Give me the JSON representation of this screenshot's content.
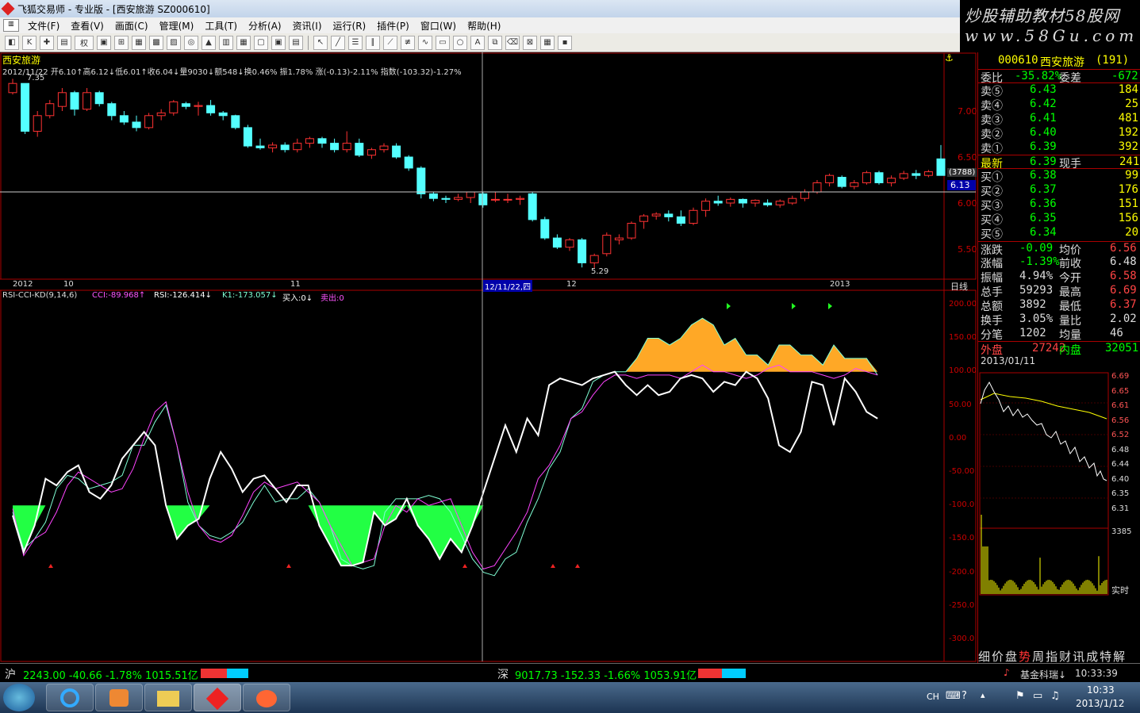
{
  "window": {
    "title": "飞狐交易师 - 专业版 - [西安旅游 SZ000610]"
  },
  "menu": [
    "文件(F)",
    "查看(V)",
    "画面(C)",
    "管理(M)",
    "工具(T)",
    "分析(A)",
    "资讯(I)",
    "运行(R)",
    "插件(P)",
    "窗口(W)",
    "帮助(H)"
  ],
  "toolbar_quan": "权",
  "brand": {
    "line1": "炒股辅助教材58股网",
    "line2": "www.58Gu.com"
  },
  "chart_header": {
    "name": "西安旅游",
    "info": "2012/11/22  开6.10↑高6.12↓低6.01↑收6.04↓量9030↓额548↓换0.46% 振1.78% 涨(-0.13)-2.11% 指数(-103.32)-1.27%"
  },
  "price_axis": {
    "labels": [
      "7.00",
      "6.50",
      "6.00",
      "5.50"
    ],
    "max_label": "7.35",
    "min_label": "5.29",
    "cursor_box": [
      "(3788)",
      "6.13"
    ],
    "period": "日线"
  },
  "date_axis": [
    "2012",
    "10",
    "11",
    "12/11/22,四",
    "12",
    "2013"
  ],
  "indicator": {
    "name": "RSI-CCI-KD(9,14,6)",
    "cci": "CCI:-89.968↑",
    "rsi": "RSI:-126.414↓",
    "k1": "K1:-173.057↓",
    "buy": "买入:0↓",
    "sell": "卖出:0",
    "axis": [
      "200.00",
      "150.00",
      "100.00",
      "50.00",
      "0.00",
      "-50.00",
      "-100.0",
      "-150.0",
      "-200.0",
      "-250.0",
      "-300.0"
    ]
  },
  "quote": {
    "code": "000610",
    "name": "西安旅游",
    "count": "(191)",
    "weibi": {
      "label": "委比",
      "value": "-35.82%",
      "label2": "委差",
      "value2": "-672"
    },
    "sell": [
      {
        "label": "卖⑤",
        "price": "6.43",
        "vol": "184"
      },
      {
        "label": "卖④",
        "price": "6.42",
        "vol": "25"
      },
      {
        "label": "卖③",
        "price": "6.41",
        "vol": "481"
      },
      {
        "label": "卖②",
        "price": "6.40",
        "vol": "192"
      },
      {
        "label": "卖①",
        "price": "6.39",
        "vol": "392"
      }
    ],
    "latest": {
      "label": "最新",
      "price": "6.39",
      "label2": "现手",
      "vol": "241"
    },
    "buy": [
      {
        "label": "买①",
        "price": "6.38",
        "vol": "99"
      },
      {
        "label": "买②",
        "price": "6.37",
        "vol": "176"
      },
      {
        "label": "买③",
        "price": "6.36",
        "vol": "151"
      },
      {
        "label": "买④",
        "price": "6.35",
        "vol": "156"
      },
      {
        "label": "买⑤",
        "price": "6.34",
        "vol": "20"
      }
    ],
    "stats": [
      {
        "l1": "涨跌",
        "v1": "-0.09",
        "l2": "均价",
        "v2": "6.56"
      },
      {
        "l1": "涨幅",
        "v1": "-1.39%",
        "l2": "前收",
        "v2": "6.48"
      },
      {
        "l1": "振幅",
        "v1": "4.94%",
        "l2": "今开",
        "v2": "6.58"
      },
      {
        "l1": "总手",
        "v1": "59293",
        "l2": "最高",
        "v2": "6.69"
      },
      {
        "l1": "总额",
        "v1": "3892",
        "l2": "最低",
        "v2": "6.37"
      },
      {
        "l1": "换手",
        "v1": "3.05%",
        "l2": "量比",
        "v2": "2.02"
      },
      {
        "l1": "分笔",
        "v1": "1202",
        "l2": "均量",
        "v2": "46"
      }
    ],
    "outer": {
      "label": "外盘",
      "value": "27242",
      "label2": "内盘",
      "value2": "32051"
    }
  },
  "mini": {
    "date": "2013/01/11",
    "ticks": [
      "6.69",
      "6.65",
      "6.61",
      "6.56",
      "6.52",
      "6.48",
      "6.44",
      "6.40",
      "6.35",
      "6.31"
    ],
    "vol_max": "3385",
    "mode": "实时"
  },
  "bottom_tabs": [
    "细",
    "价",
    "盘",
    "势",
    "周",
    "指",
    "财",
    "讯",
    "成",
    "特",
    "解"
  ],
  "status": {
    "sh_label": "沪",
    "sh": "2243.00 -40.66 -1.78% 1015.51亿",
    "sz_label": "深",
    "sz": "9017.73 -152.33 -1.66% 1053.91亿",
    "fund": "基金科瑞↓",
    "time": "10:33:39"
  },
  "taskbar": {
    "time": "10:33",
    "date": "2013/1/12",
    "lang": "CH"
  },
  "chart_data": {
    "type": "candlestick",
    "ohlc": [
      [
        7.2,
        7.35,
        7.18,
        7.3
      ],
      [
        7.3,
        7.3,
        6.75,
        6.78
      ],
      [
        6.78,
        7.0,
        6.72,
        6.95
      ],
      [
        6.95,
        7.12,
        6.92,
        7.08
      ],
      [
        7.05,
        7.25,
        7.0,
        7.2
      ],
      [
        7.2,
        7.22,
        6.95,
        7.02
      ],
      [
        7.02,
        7.25,
        7.0,
        7.2
      ],
      [
        7.2,
        7.22,
        7.05,
        7.08
      ],
      [
        7.08,
        7.1,
        6.9,
        6.95
      ],
      [
        6.95,
        7.0,
        6.85,
        6.88
      ],
      [
        6.88,
        6.95,
        6.78,
        6.82
      ],
      [
        6.82,
        6.98,
        6.8,
        6.95
      ],
      [
        6.95,
        7.02,
        6.9,
        6.98
      ],
      [
        6.98,
        7.12,
        6.95,
        7.1
      ],
      [
        7.08,
        7.1,
        7.02,
        7.05
      ],
      [
        7.05,
        7.1,
        6.95,
        7.06
      ],
      [
        7.06,
        7.12,
        6.95,
        6.98
      ],
      [
        6.98,
        7.0,
        6.9,
        6.95
      ],
      [
        6.95,
        6.96,
        6.8,
        6.82
      ],
      [
        6.82,
        6.85,
        6.6,
        6.62
      ],
      [
        6.62,
        6.7,
        6.58,
        6.6
      ],
      [
        6.6,
        6.66,
        6.55,
        6.63
      ],
      [
        6.63,
        6.66,
        6.55,
        6.58
      ],
      [
        6.58,
        6.7,
        6.55,
        6.65
      ],
      [
        6.65,
        6.72,
        6.6,
        6.7
      ],
      [
        6.7,
        6.72,
        6.6,
        6.65
      ],
      [
        6.65,
        6.7,
        6.55,
        6.58
      ],
      [
        6.58,
        6.78,
        6.55,
        6.65
      ],
      [
        6.65,
        6.7,
        6.5,
        6.52
      ],
      [
        6.52,
        6.6,
        6.48,
        6.58
      ],
      [
        6.58,
        6.65,
        6.55,
        6.62
      ],
      [
        6.62,
        6.65,
        6.48,
        6.5
      ],
      [
        6.5,
        6.52,
        6.35,
        6.38
      ],
      [
        6.38,
        6.4,
        6.05,
        6.1
      ],
      [
        6.1,
        6.12,
        6.02,
        6.05
      ],
      [
        6.05,
        6.08,
        6.0,
        6.04
      ],
      [
        6.04,
        6.1,
        6.02,
        6.06
      ],
      [
        6.06,
        6.12,
        6.0,
        6.12
      ],
      [
        6.1,
        6.12,
        5.95,
        5.98
      ],
      [
        6.04,
        6.12,
        6.01,
        6.04
      ],
      [
        6.04,
        6.1,
        6.0,
        6.04
      ],
      [
        6.04,
        6.08,
        5.98,
        6.05
      ],
      [
        6.1,
        6.12,
        5.8,
        5.82
      ],
      [
        5.82,
        5.85,
        5.6,
        5.62
      ],
      [
        5.62,
        5.66,
        5.5,
        5.52
      ],
      [
        5.52,
        5.62,
        5.48,
        5.6
      ],
      [
        5.6,
        5.62,
        5.3,
        5.35
      ],
      [
        5.35,
        5.45,
        5.29,
        5.43
      ],
      [
        5.45,
        5.68,
        5.42,
        5.65
      ],
      [
        5.6,
        5.66,
        5.55,
        5.62
      ],
      [
        5.62,
        5.8,
        5.6,
        5.78
      ],
      [
        5.8,
        5.88,
        5.72,
        5.86
      ],
      [
        5.86,
        5.9,
        5.82,
        5.88
      ],
      [
        5.88,
        5.92,
        5.8,
        5.85
      ],
      [
        5.85,
        5.92,
        5.75,
        5.78
      ],
      [
        5.78,
        5.95,
        5.76,
        5.92
      ],
      [
        5.92,
        6.05,
        5.85,
        6.02
      ],
      [
        6.02,
        6.08,
        5.97,
        6.0
      ],
      [
        6.0,
        6.06,
        5.96,
        6.04
      ],
      [
        6.04,
        6.05,
        5.95,
        6.0
      ],
      [
        6.0,
        6.04,
        5.96,
        6.03
      ],
      [
        6.0,
        6.04,
        5.96,
        5.98
      ],
      [
        5.98,
        6.04,
        5.95,
        6.02
      ],
      [
        6.0,
        6.08,
        5.98,
        6.05
      ],
      [
        6.05,
        6.15,
        6.02,
        6.12
      ],
      [
        6.12,
        6.25,
        6.1,
        6.22
      ],
      [
        6.22,
        6.32,
        6.18,
        6.3
      ],
      [
        6.28,
        6.3,
        6.16,
        6.18
      ],
      [
        6.18,
        6.25,
        6.15,
        6.22
      ],
      [
        6.22,
        6.35,
        6.2,
        6.33
      ],
      [
        6.33,
        6.35,
        6.2,
        6.22
      ],
      [
        6.22,
        6.3,
        6.18,
        6.27
      ],
      [
        6.27,
        6.35,
        6.25,
        6.32
      ],
      [
        6.32,
        6.36,
        6.26,
        6.3
      ],
      [
        6.3,
        6.36,
        6.28,
        6.34
      ],
      [
        6.48,
        6.63,
        6.3,
        6.3
      ]
    ],
    "indicator": {
      "k1": [
        -110,
        -165,
        -150,
        -125,
        -75,
        -55,
        -60,
        -75,
        -70,
        -65,
        -55,
        -10,
        -10,
        25,
        50,
        -10,
        -95,
        -130,
        -145,
        -150,
        -140,
        -125,
        -95,
        -70,
        -95,
        -90,
        -90,
        -75,
        -95,
        -130,
        -180,
        -190,
        -195,
        -190,
        -110,
        -90,
        -90,
        -90,
        -85,
        -90,
        -110,
        -145,
        -180,
        -200,
        -205,
        -180,
        -170,
        -125,
        -90,
        -45,
        -20,
        30,
        45,
        85,
        95,
        100,
        100,
        120,
        150,
        150,
        140,
        150,
        170,
        180,
        170,
        140,
        150,
        125,
        125,
        110,
        140,
        140,
        125,
        125,
        110,
        140,
        120,
        120,
        120,
        95
      ],
      "cci": [
        -105,
        -175,
        -150,
        -140,
        -110,
        -70,
        -50,
        -60,
        -70,
        -80,
        -75,
        -45,
        0,
        40,
        55,
        -10,
        -80,
        -130,
        -150,
        -155,
        -145,
        -115,
        -80,
        -65,
        -75,
        -70,
        -65,
        -80,
        -95,
        -130,
        -160,
        -190,
        -185,
        -180,
        -130,
        -100,
        -110,
        -90,
        -100,
        -95,
        -90,
        -130,
        -170,
        -195,
        -190,
        -165,
        -140,
        -110,
        -60,
        -40,
        -10,
        30,
        40,
        65,
        85,
        95,
        95,
        90,
        95,
        95,
        95,
        90,
        100,
        110,
        100,
        100,
        95,
        90,
        95,
        105,
        110,
        100,
        100,
        100,
        95,
        90,
        95,
        105,
        100,
        95
      ],
      "rsi": [
        -115,
        -170,
        -130,
        -60,
        -70,
        -50,
        -40,
        -80,
        -90,
        -70,
        -30,
        -10,
        10,
        -10,
        -100,
        -150,
        -130,
        -120,
        -60,
        -20,
        -45,
        -80,
        -60,
        -55,
        -75,
        -95,
        -70,
        -70,
        -130,
        -160,
        -190,
        -190,
        -185,
        -110,
        -130,
        -120,
        -90,
        -130,
        -150,
        -180,
        -150,
        -170,
        -130,
        -80,
        -30,
        20,
        -20,
        30,
        5,
        80,
        90,
        85,
        80,
        90,
        95,
        100,
        80,
        65,
        80,
        65,
        70,
        90,
        95,
        90,
        70,
        85,
        80,
        100,
        90,
        60,
        -10,
        -20,
        10,
        85,
        80,
        20,
        90,
        70,
        40,
        30
      ]
    }
  }
}
